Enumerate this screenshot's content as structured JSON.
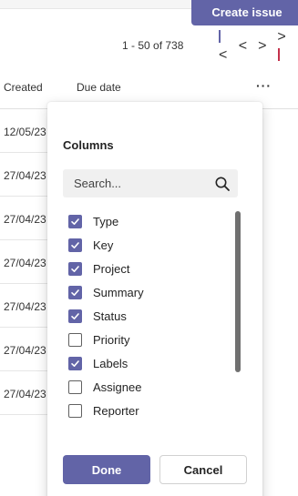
{
  "header": {
    "create_issue_label": "Create issue"
  },
  "pagination": {
    "range_text": "1 - 50 of 738",
    "first_label": "|<",
    "prev_label": "<",
    "next_label": ">",
    "last_label": ">|"
  },
  "table": {
    "columns": [
      "Created",
      "Due date"
    ],
    "more_label": "···",
    "rows": [
      {
        "created": "12/05/23"
      },
      {
        "created": "27/04/23"
      },
      {
        "created": "27/04/23"
      },
      {
        "created": "27/04/23"
      },
      {
        "created": "27/04/23"
      },
      {
        "created": "27/04/23"
      },
      {
        "created": "27/04/23"
      }
    ]
  },
  "columns_panel": {
    "title": "Columns",
    "search_placeholder": "Search...",
    "options": [
      {
        "label": "Type",
        "checked": true
      },
      {
        "label": "Key",
        "checked": true
      },
      {
        "label": "Project",
        "checked": true
      },
      {
        "label": "Summary",
        "checked": true
      },
      {
        "label": "Status",
        "checked": true
      },
      {
        "label": "Priority",
        "checked": false
      },
      {
        "label": "Labels",
        "checked": true
      },
      {
        "label": "Assignee",
        "checked": false
      },
      {
        "label": "Reporter",
        "checked": false
      }
    ],
    "done_label": "Done",
    "cancel_label": "Cancel"
  },
  "colors": {
    "accent": "#6264a7",
    "panel_bg": "#ffffff",
    "search_bg": "#f0f0f0"
  }
}
